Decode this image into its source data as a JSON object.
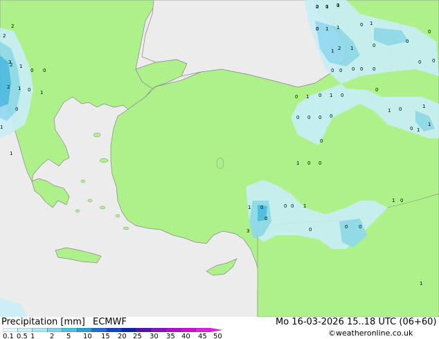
{
  "header": {
    "product_label": "Precipitation [mm]",
    "model_label": "ECMWF",
    "valid_time": "Mo 16-03-2026 15..18 UTC (06+60)",
    "credit": "©weatheronline.co.uk"
  },
  "legend": {
    "ticks": [
      "0.1",
      "0.5",
      "1",
      "2",
      "5",
      "10",
      "15",
      "20",
      "25",
      "30",
      "35",
      "40",
      "45",
      "50"
    ],
    "colors": [
      "#e2f7fb",
      "#c8eff6",
      "#a8e4f2",
      "#7dd3eb",
      "#4fbfe4",
      "#2aa0db",
      "#1d6fd2",
      "#1345c8",
      "#0a27a8",
      "#5a10a8",
      "#8a10c0",
      "#b010c8",
      "#d010d0",
      "#e020e0"
    ]
  },
  "map": {
    "colors": {
      "land_rain_free": "#aef08a",
      "sea": "#ececec",
      "coast_line": "#888888",
      "rain_light": "#c8eef8",
      "rain_mod": "#8ed8f0",
      "rain_heavy": "#4cb8e6"
    },
    "value_labels": [
      "2",
      "1",
      "1",
      "0",
      "1",
      "1",
      "0",
      "1",
      "0",
      "2",
      "1",
      "0",
      "1",
      "0",
      "0",
      "0",
      "0",
      "0",
      "0",
      "0",
      "0",
      "2",
      "1",
      "0",
      "3",
      "2",
      "1",
      "0",
      "2",
      "2",
      "1",
      "0",
      "0",
      "1",
      "0",
      "1",
      "0",
      "0",
      "0",
      "0",
      "0",
      "0",
      "1",
      "0",
      "1",
      "0",
      "1",
      "1",
      "0",
      "1",
      "0",
      "0",
      "1",
      "0",
      "0",
      "0",
      "0",
      "1",
      "0",
      "3",
      "0",
      "0",
      "1",
      "0",
      "1",
      "1",
      "0",
      "1",
      "0",
      "0",
      "0",
      "0"
    ]
  }
}
